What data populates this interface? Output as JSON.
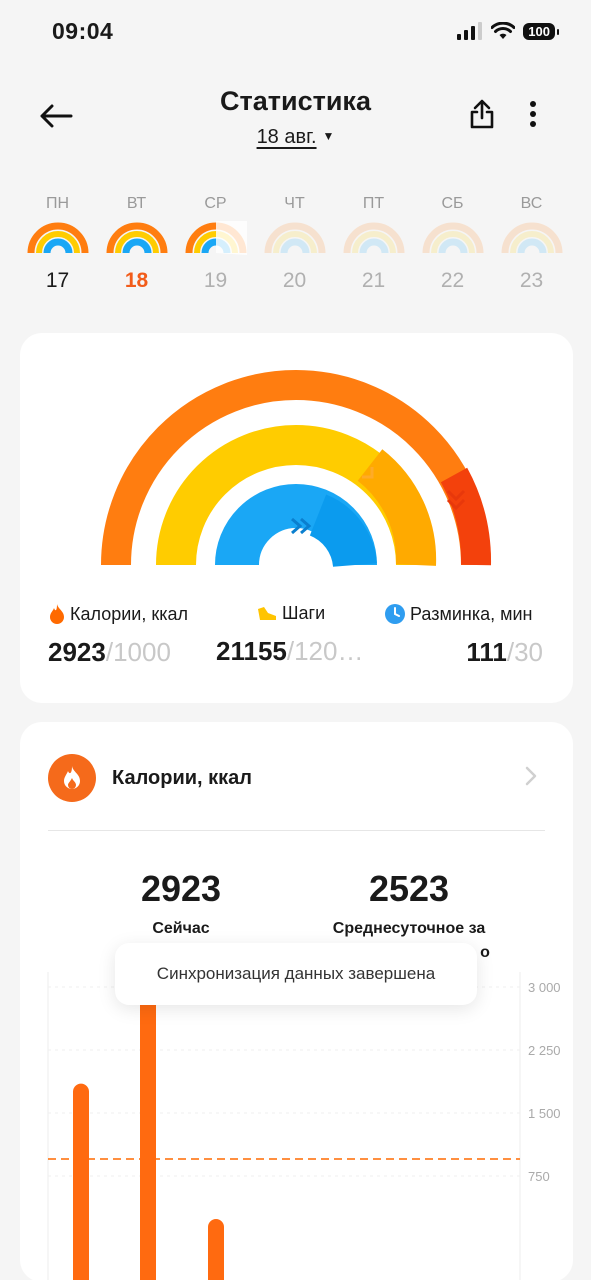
{
  "status_bar": {
    "time": "09:04",
    "battery": "100"
  },
  "header": {
    "title": "Статистика",
    "date": "18 авг."
  },
  "week": [
    {
      "label": "ПН",
      "num": "17",
      "state": "past"
    },
    {
      "label": "ВТ",
      "num": "18",
      "state": "selected"
    },
    {
      "label": "СР",
      "num": "19",
      "state": "partial"
    },
    {
      "label": "ЧТ",
      "num": "20",
      "state": "future"
    },
    {
      "label": "ПТ",
      "num": "21",
      "state": "future"
    },
    {
      "label": "СБ",
      "num": "22",
      "state": "future"
    },
    {
      "label": "ВС",
      "num": "23",
      "state": "future"
    }
  ],
  "summary": {
    "calories": {
      "label": "Калории, ккал",
      "value": "2923",
      "goal": "/1000"
    },
    "steps": {
      "label": "Шаги",
      "value": "21155",
      "goal": "/120…"
    },
    "warmup": {
      "label": "Разминка, мин",
      "value": "111",
      "goal": "/30"
    }
  },
  "calories_card": {
    "title": "Калории, ккал",
    "now_value": "2923",
    "now_caption": "Сейчас",
    "avg_value": "2523",
    "avg_caption": "Среднесуточное за",
    "avg_caption_tail": "о"
  },
  "chart_data": {
    "type": "bar",
    "y_ticks": [
      "3 000",
      "2 250",
      "1 500",
      "750"
    ],
    "ylim": [
      0,
      3000
    ],
    "reference_line": 1000,
    "values": [
      1850,
      3000,
      150
    ]
  },
  "toast": {
    "text": "Синхронизация данных завершена"
  },
  "colors": {
    "orange": "#ff7d10",
    "yellow": "#ffcc00",
    "blue": "#1aa7f5",
    "red": "#f3410c",
    "selected": "#f25c1a"
  }
}
